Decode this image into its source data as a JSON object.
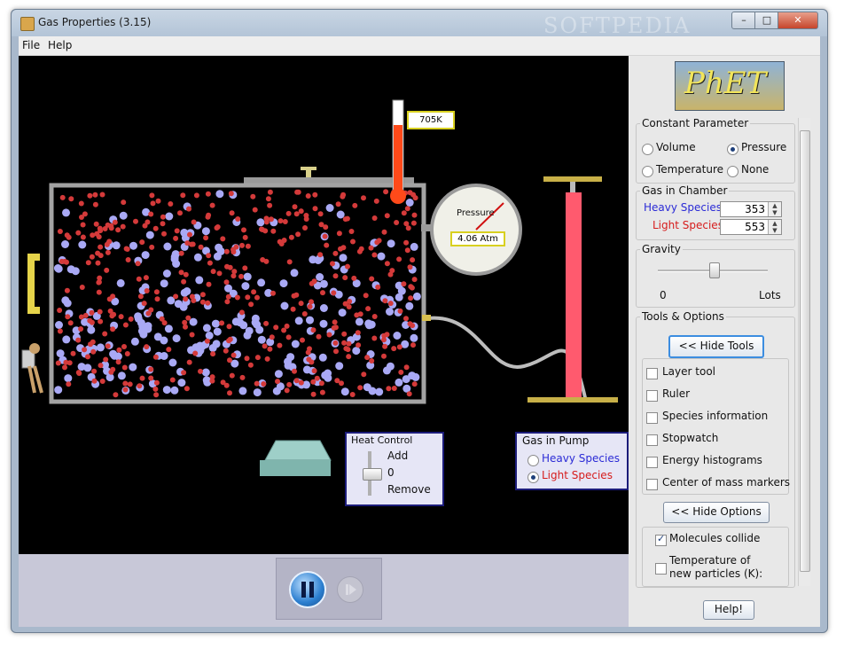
{
  "window": {
    "title": "Gas Properties (3.15)",
    "watermark": "SOFTPEDIA"
  },
  "menu": {
    "file": "File",
    "help": "Help"
  },
  "thermometer": {
    "value": "705K"
  },
  "gauge": {
    "label": "Pressure",
    "value": "4.06 Atm"
  },
  "heat_control": {
    "title": "Heat Control",
    "add": "Add",
    "zero": "0",
    "remove": "Remove"
  },
  "gas_in_pump": {
    "title": "Gas in Pump",
    "heavy": "Heavy Species",
    "light": "Light Species",
    "selected": "light"
  },
  "logo": {
    "text": "PhET"
  },
  "constant_parameter": {
    "title": "Constant Parameter",
    "volume": "Volume",
    "pressure": "Pressure",
    "temperature": "Temperature",
    "none": "None",
    "selected": "pressure"
  },
  "gas_in_chamber": {
    "title": "Gas in Chamber",
    "heavy_label": "Heavy Species",
    "heavy_value": "353",
    "light_label": "Light Species",
    "light_value": "553"
  },
  "gravity": {
    "title": "Gravity",
    "min_label": "0",
    "max_label": "Lots",
    "level": 0.55
  },
  "tools": {
    "title": "Tools & Options",
    "hide_tools": "<< Hide Tools",
    "layer": "Layer tool",
    "ruler": "Ruler",
    "species": "Species information",
    "stopwatch": "Stopwatch",
    "energy": "Energy histograms",
    "center": "Center of mass markers"
  },
  "options": {
    "hide_options": "<< Hide Options",
    "collide": "Molecules collide",
    "temp_new_1": "Temperature of",
    "temp_new_2": "new particles (K):"
  },
  "help_button": "Help!",
  "colors": {
    "heavy": "#2b2bd6",
    "light": "#d61c1c",
    "heavy_particle": "#a9a9f5",
    "light_particle": "#d43a3a"
  }
}
